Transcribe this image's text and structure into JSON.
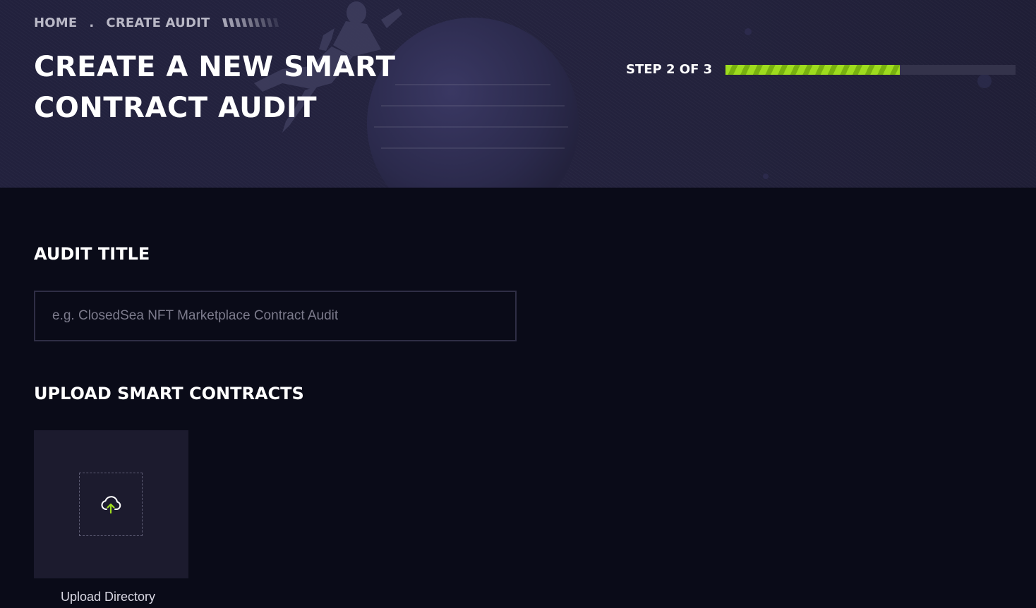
{
  "breadcrumb": {
    "home": "HOME",
    "separator": ".",
    "current": "CREATE AUDIT"
  },
  "hero": {
    "title": "CREATE A NEW SMART CONTRACT AUDIT"
  },
  "progress": {
    "label": "STEP 2 OF 3",
    "current_step": 2,
    "total_steps": 3,
    "fill_fraction": 0.6
  },
  "audit_title": {
    "heading": "AUDIT TITLE",
    "input_value": "",
    "placeholder": "e.g. ClosedSea NFT Marketplace Contract Audit"
  },
  "upload": {
    "heading": "UPLOAD SMART CONTRACTS",
    "tile_label": "Upload Directory",
    "icon": "cloud-upload-icon"
  },
  "colors": {
    "background": "#0a0b18",
    "hero_background": "#23223d",
    "accent": "#9edc1e",
    "progress_track": "#34334b",
    "tile_background": "#1c1b2e",
    "input_border": "#2f2e45",
    "placeholder_text": "#7c7b8c"
  }
}
